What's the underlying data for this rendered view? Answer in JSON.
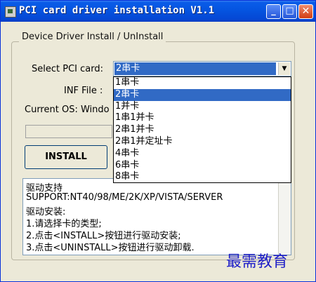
{
  "window": {
    "title": "PCI card driver installation V1.1",
    "minimize_label": "_",
    "maximize_label": "□",
    "close_label": "✕"
  },
  "group": {
    "legend": "Device Driver Install / UnInstall"
  },
  "form": {
    "select_label": "Select PCI card:",
    "selected_value": "2串卡",
    "dropdown_arrow": "▼",
    "inf_label": "INF File :",
    "os_label": "Current OS: Windo"
  },
  "dropdown": {
    "options": [
      "1串卡",
      "2串卡",
      "1并卡",
      "1串1并卡",
      "2串1并卡",
      "2串1并定址卡",
      "4串卡",
      "6串卡",
      "8串卡"
    ],
    "highlighted_index": 1
  },
  "buttons": {
    "install": "INSTALL"
  },
  "info": {
    "lines": [
      "驱动支持",
      "SUPPORT:NT40/98/ME/2K/XP/VISTA/SERVER",
      "驱动安装:",
      "1.请选择卡的类型;",
      "2.点击<INSTALL>按钮进行驱动安装;",
      "3.点击<UNINSTALL>按钮进行驱动卸载."
    ]
  },
  "watermark": "最需教育"
}
